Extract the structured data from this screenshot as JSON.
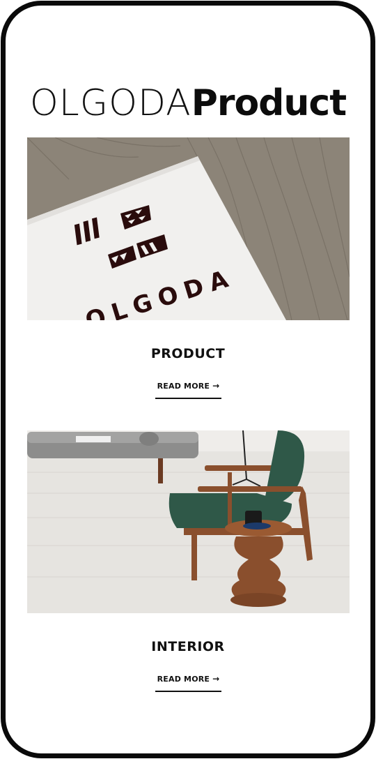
{
  "header": {
    "brand_light": "OLGODA",
    "brand_bold": "Product"
  },
  "cards": [
    {
      "title": "PRODUCT",
      "link_label": "READ MORE",
      "logo_text": "OLGODA"
    },
    {
      "title": "INTERIOR",
      "link_label": "READ MORE"
    }
  ],
  "icons": {
    "link_arrow": "arrow-right-icon"
  },
  "colors": {
    "frame": "#0a0a0a",
    "text": "#111111",
    "logo": "#2a0c0c"
  }
}
